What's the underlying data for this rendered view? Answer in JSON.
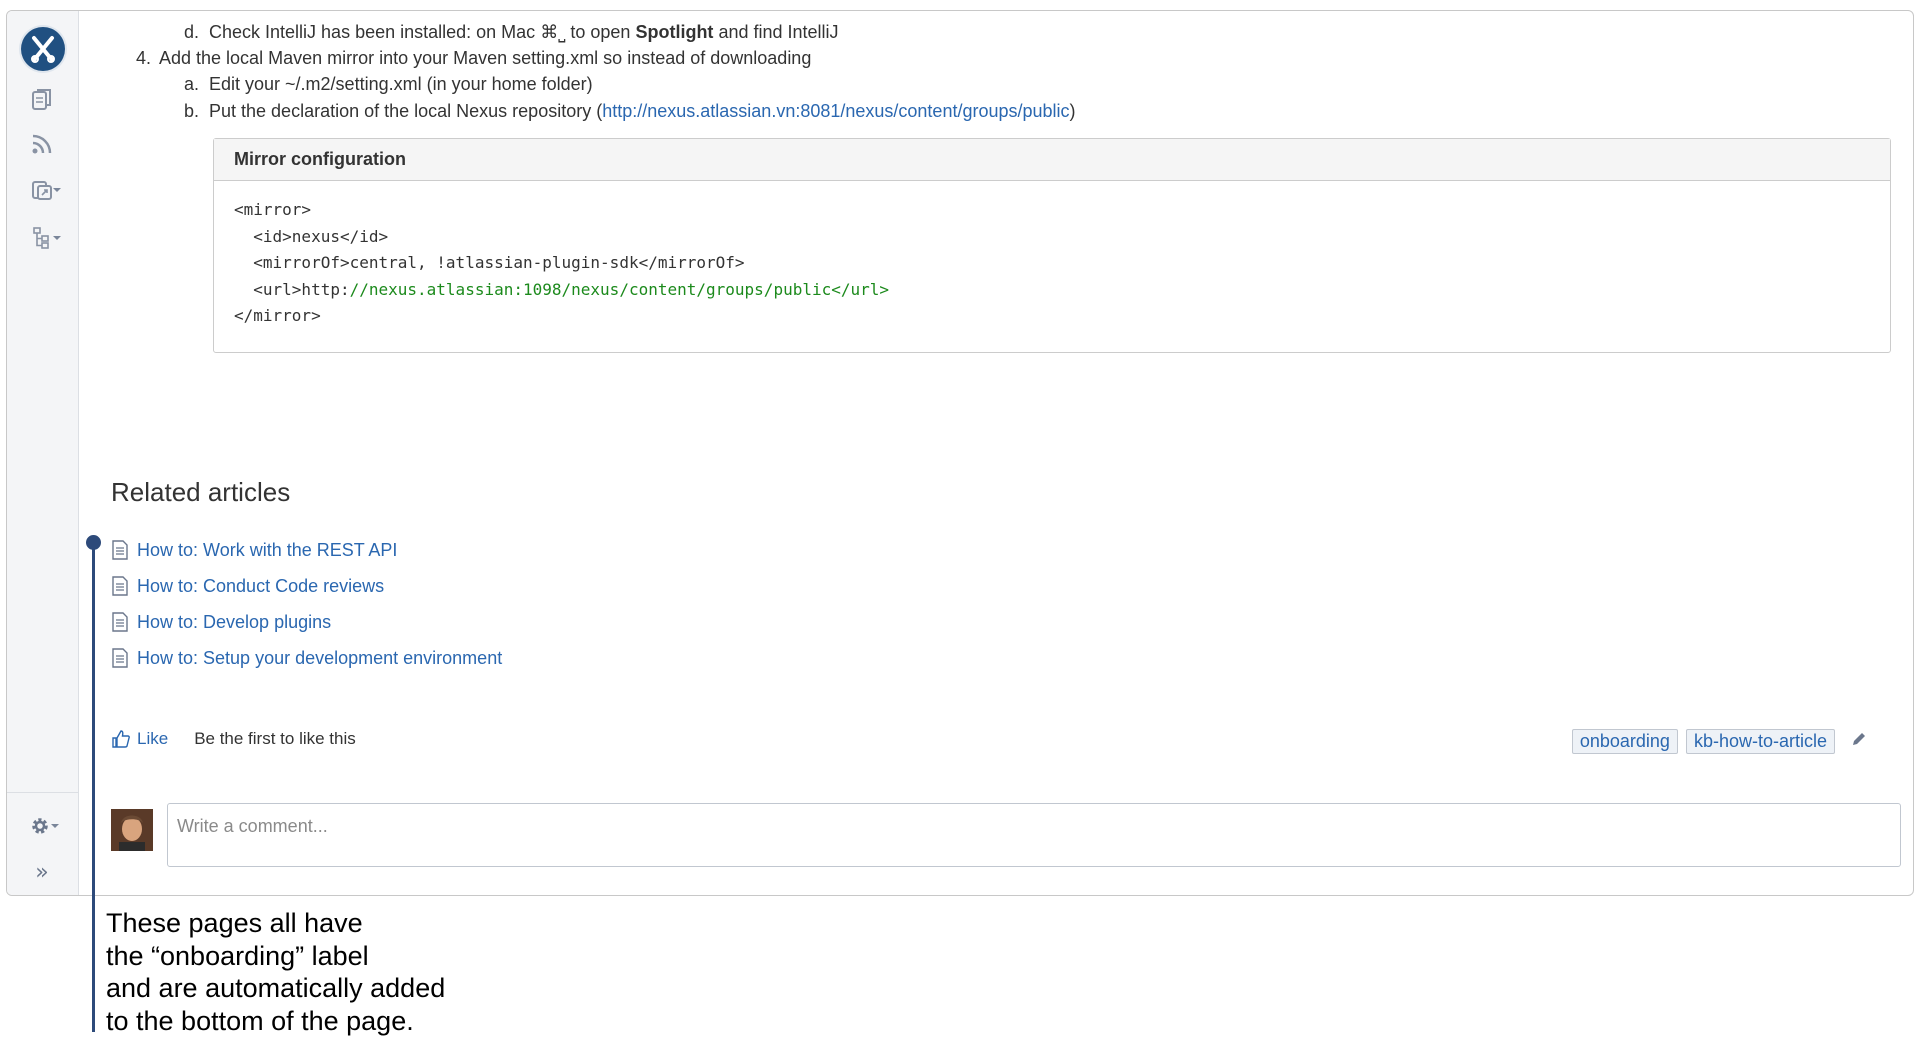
{
  "steps": {
    "step_d": {
      "letter": "d.",
      "before": "Check IntelliJ has been installed: on Mac ",
      "shortcut": "⌘⎵",
      "mid": " to open ",
      "bold": "Spotlight",
      "after": " and find IntelliJ"
    },
    "step_4": {
      "number": "4.",
      "text": "Add the local Maven mirror into your Maven setting.xml so instead of downloading"
    },
    "step_4a": {
      "letter": "a.",
      "text": "Edit your ~/.m2/setting.xml (in your home folder)"
    },
    "step_4b": {
      "letter": "b.",
      "before": "Put the declaration of the local Nexus repository (",
      "link": "http://nexus.atlassian.vn:8081/nexus/content/groups/public",
      "after": ")"
    }
  },
  "code_block": {
    "title": "Mirror configuration",
    "line1": "<mirror>",
    "line2": "  <id>nexus</id>",
    "line3": "  <mirrorOf>central, !atlassian-plugin-sdk</mirrorOf>",
    "line4_prefix": "  <url>http:",
    "line4_rest": "//nexus.atlassian:1098/nexus/content/groups/public</url>",
    "line5": "</mirror>"
  },
  "related": {
    "title": "Related articles",
    "items": [
      {
        "label": "How to: Work with the REST API"
      },
      {
        "label": "How to: Conduct Code reviews"
      },
      {
        "label": "How to: Develop plugins"
      },
      {
        "label": "How to: Setup your development environment"
      }
    ]
  },
  "like": {
    "button": "Like",
    "status": "Be the first to like this"
  },
  "labels": {
    "items": [
      "onboarding",
      "kb-how-to-article"
    ]
  },
  "comment": {
    "placeholder": "Write a comment..."
  },
  "annotation": {
    "line1": "These pages all have",
    "line2": "the “onboarding” label",
    "line3": "and are automatically added",
    "line4": "to the bottom of the page."
  },
  "colors": {
    "link": "#2a67b0",
    "annotation": "#2d4a7a",
    "code_url": "#1c8a1c",
    "logo": "#205081"
  },
  "sidebar_icons": [
    "pages-icon",
    "feed-icon",
    "create-from-template-icon",
    "page-tree-icon",
    "settings-icon",
    "expand-icon"
  ]
}
